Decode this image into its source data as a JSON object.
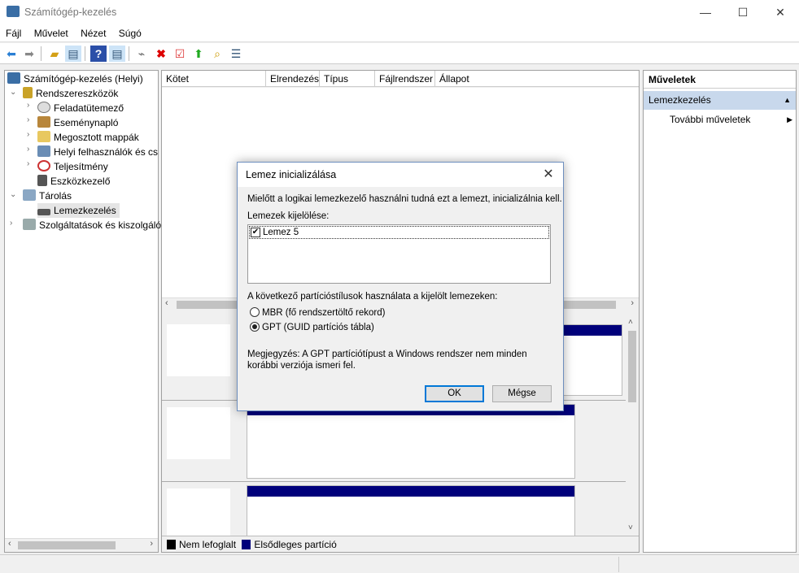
{
  "window": {
    "title": "Számítógép-kezelés",
    "minimize": "—",
    "maximize": "☐",
    "close": "✕"
  },
  "menu": [
    "Fájl",
    "Művelet",
    "Nézet",
    "Súgó"
  ],
  "toolbar": [
    "back-icon",
    "forward-icon",
    "up-folder-icon",
    "show-hide-tree-icon",
    "help-icon",
    "show-hide-action-icon",
    "connect-icon",
    "delete-icon",
    "properties-icon",
    "import-icon",
    "search-icon",
    "list-icon"
  ],
  "tree": {
    "root": "Számítógép-kezelés (Helyi)",
    "items": [
      {
        "label": "Rendszereszközök",
        "level": 1,
        "expanded": true
      },
      {
        "label": "Feladatütemező",
        "level": 2
      },
      {
        "label": "Eseménynapló",
        "level": 2
      },
      {
        "label": "Megosztott mappák",
        "level": 2
      },
      {
        "label": "Helyi felhasználók és cs",
        "level": 2
      },
      {
        "label": "Teljesítmény",
        "level": 2
      },
      {
        "label": "Eszközkezelő",
        "level": 2
      },
      {
        "label": "Tárolás",
        "level": 1,
        "expanded": true
      },
      {
        "label": "Lemezkezelés",
        "level": 2,
        "selected": true
      },
      {
        "label": "Szolgáltatások és kiszolgáló",
        "level": 1
      }
    ]
  },
  "volumes": {
    "columns": [
      "Kötet",
      "Elrendezés",
      "Típus",
      "Fájlrendszer",
      "Állapot"
    ]
  },
  "legend": [
    {
      "label": "Nem lefoglalt",
      "color": "#000000"
    },
    {
      "label": "Elsődleges partíció",
      "color": "#00007b"
    }
  ],
  "actions": {
    "header": "Műveletek",
    "section": "Lemezkezelés",
    "more": "További műveletek"
  },
  "dialog": {
    "title": "Lemez inicializálása",
    "intro": "Mielőtt a logikai lemezkezelő használni tudná ezt a lemezt, inicializálnia kell.",
    "select_label": "Lemezek kijelölése:",
    "disks": [
      {
        "label": "Lemez 5",
        "checked": true
      }
    ],
    "style_label": "A következő partícióstílusok használata a kijelölt lemezeken:",
    "options": [
      {
        "label": "MBR (fő rendszertöltő rekord)",
        "selected": false
      },
      {
        "label": "GPT (GUID partíciós tábla)",
        "selected": true
      }
    ],
    "note": "Megjegyzés: A GPT partíciótípust a Windows rendszer nem minden korábbi verziója ismeri fel.",
    "ok": "OK",
    "cancel": "Mégse"
  }
}
